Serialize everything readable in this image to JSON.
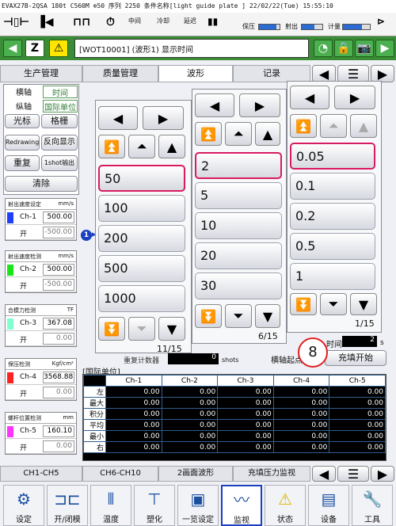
{
  "titlebar": "EVAX27B-2QSA 180t C560M  ⊕50 序列 2250 条件名称[light guide plate   ]   22/02/22(Tue) 15:55:10",
  "topbar": {
    "pressure_label": "保压",
    "eject_label": "射出",
    "meter_label": "计量",
    "counters": [
      "中间",
      "冷却",
      "延迟"
    ],
    "pressure_fill": 0.85,
    "eject_fill": 0.6,
    "meter_fill": 0.7
  },
  "message": "[WOT10001] (波形1) 显示时间",
  "tabs": [
    "生产管理",
    "质量管理",
    "波形",
    "记录"
  ],
  "left": {
    "x_axis_label": "横轴",
    "x_axis_value": "时间",
    "y_axis_label": "纵轴",
    "y_axis_value": "国际单位",
    "cursor_btn": "光标",
    "grid_btn": "格栅",
    "redraw_btn": "Redrawing",
    "reverse_btn": "反向显示",
    "repeat_btn": "重复",
    "oneshot_btn": "1shot输出",
    "clear_btn": "清除"
  },
  "channels": [
    {
      "title": "射出速度设定",
      "unit": "mm/s",
      "name": "Ch-1",
      "color": "#1f3fff",
      "max": "500.00",
      "min_label": "开",
      "min": "-500.00"
    },
    {
      "title": "射出速度检测",
      "unit": "mm/s",
      "name": "Ch-2",
      "color": "#19e619",
      "max": "500.00",
      "min_label": "开",
      "min": "-500.00"
    },
    {
      "title": "合模力检测",
      "unit": "TF",
      "name": "Ch-3",
      "color": "#7fffd0",
      "max": "367.08",
      "min_label": "开",
      "min": "0.00"
    },
    {
      "title": "保压检测",
      "unit": "Kgf/cm²",
      "name": "Ch-4",
      "color": "#ff2020",
      "max": "3568.88",
      "min_label": "开",
      "min": "0.00"
    },
    {
      "title": "螺杆位置检测",
      "unit": "mm",
      "name": "Ch-5",
      "color": "#ff33ff",
      "max": "160.10",
      "min_label": "开",
      "min": "0.00"
    }
  ],
  "picker1": {
    "values": [
      "50",
      "100",
      "200",
      "500",
      "1000"
    ],
    "page": "11/15"
  },
  "picker2": {
    "values": [
      "2",
      "5",
      "10",
      "20",
      "30"
    ],
    "page": "6/15"
  },
  "picker3": {
    "values": [
      "0.05",
      "0.1",
      "0.2",
      "0.5",
      "1"
    ],
    "page": "1/15"
  },
  "misc": {
    "repeat_count_label": "重复计数器",
    "repeat_count": "0",
    "shots": "shots",
    "x_start_label": "横轴起点",
    "fill_start": "充填开始",
    "time_label": "时间",
    "time_value": "2",
    "time_unit": "s",
    "badge": "8",
    "marker": "1"
  },
  "grid": {
    "title": "[国际单位]",
    "headers": [
      "Ch-1",
      "Ch-2",
      "Ch-3",
      "Ch-4",
      "Ch-5"
    ],
    "rows": [
      {
        "label": "左",
        "vals": [
          "0.00",
          "0.00",
          "0.00",
          "0.00",
          "0.00"
        ]
      },
      {
        "label": "最大",
        "vals": [
          "0.00",
          "0.00",
          "0.00",
          "0.00",
          "0.00"
        ]
      },
      {
        "label": "积分",
        "vals": [
          "0.00",
          "0.00",
          "0.00",
          "0.00",
          "0.00"
        ]
      },
      {
        "label": "平均",
        "vals": [
          "0.00",
          "0.00",
          "0.00",
          "0.00",
          "0.00"
        ]
      },
      {
        "label": "最小",
        "vals": [
          "0.00",
          "0.00",
          "0.00",
          "0.00",
          "0.00"
        ]
      },
      {
        "label": "右",
        "vals": [
          "0.00",
          "0.00",
          "0.00",
          "0.00",
          "0.00"
        ]
      }
    ]
  },
  "bottom_tabs": [
    "CH1-CH5",
    "CH6-CH10",
    "2画面波形",
    "充填压力监视"
  ],
  "nav": [
    "设定",
    "开/闭模",
    "温度",
    "塑化",
    "一览设定",
    "监视",
    "状态",
    "设备",
    "工具"
  ]
}
